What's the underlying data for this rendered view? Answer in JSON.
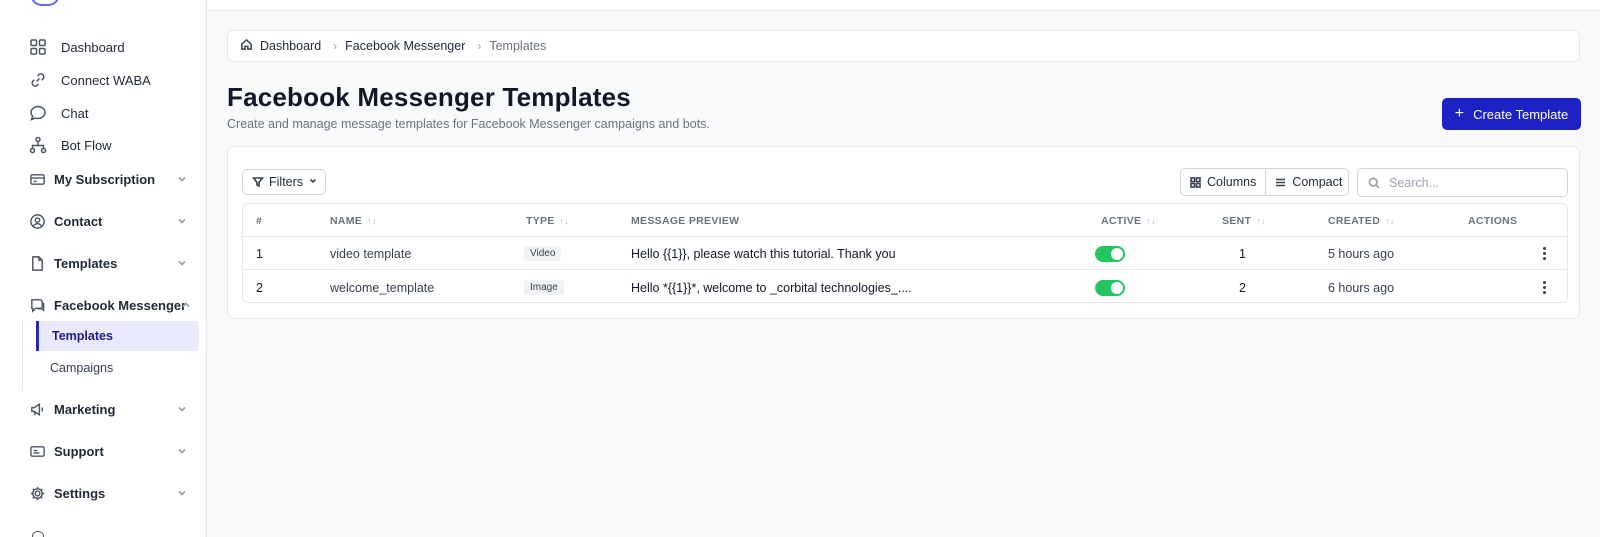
{
  "sidebar": {
    "items": [
      {
        "label": "Dashboard",
        "icon": "grid-icon"
      },
      {
        "label": "Connect WABA",
        "icon": "link-icon"
      },
      {
        "label": "Chat",
        "icon": "chat-bubble-icon"
      },
      {
        "label": "Bot Flow",
        "icon": "flow-icon"
      }
    ],
    "groups": [
      {
        "label": "My Subscription",
        "icon": "card-icon"
      },
      {
        "label": "Contact",
        "icon": "user-circle-icon"
      },
      {
        "label": "Templates",
        "icon": "document-icon"
      },
      {
        "label": "Facebook Messenger",
        "icon": "messenger-icon"
      },
      {
        "label": "Marketing",
        "icon": "megaphone-icon"
      },
      {
        "label": "Support",
        "icon": "ticket-icon"
      },
      {
        "label": "Settings",
        "icon": "gear-icon"
      }
    ],
    "sub_items": [
      {
        "label": "Templates",
        "active": true
      },
      {
        "label": "Campaigns",
        "active": false
      }
    ]
  },
  "breadcrumb": {
    "items": [
      "Dashboard",
      "Facebook Messenger",
      "Templates"
    ]
  },
  "page": {
    "title": "Facebook Messenger Templates",
    "subtitle": "Create and manage message templates for Facebook Messenger campaigns and bots.",
    "create_label": "Create Template"
  },
  "toolbar": {
    "filters_label": "Filters",
    "columns_label": "Columns",
    "compact_label": "Compact",
    "search_placeholder": "Search..."
  },
  "table": {
    "headers": [
      "#",
      "NAME",
      "TYPE",
      "MESSAGE PREVIEW",
      "ACTIVE",
      "SENT",
      "CREATED",
      "ACTIONS"
    ],
    "rows": [
      {
        "num": "1",
        "name": "video template",
        "type": "Video",
        "preview": "Hello {{1}}, please watch this tutorial. Thank you",
        "active": true,
        "sent": "1",
        "created": "5 hours ago"
      },
      {
        "num": "2",
        "name": "welcome_template",
        "type": "Image",
        "preview": "Hello *{{1}}*, welcome to _corbital technologies_....",
        "active": true,
        "sent": "2",
        "created": "6 hours ago"
      }
    ]
  },
  "colors": {
    "accent": "#1e21c4",
    "toggle_on": "#22c55e",
    "active_bg": "#e8e9fb"
  }
}
